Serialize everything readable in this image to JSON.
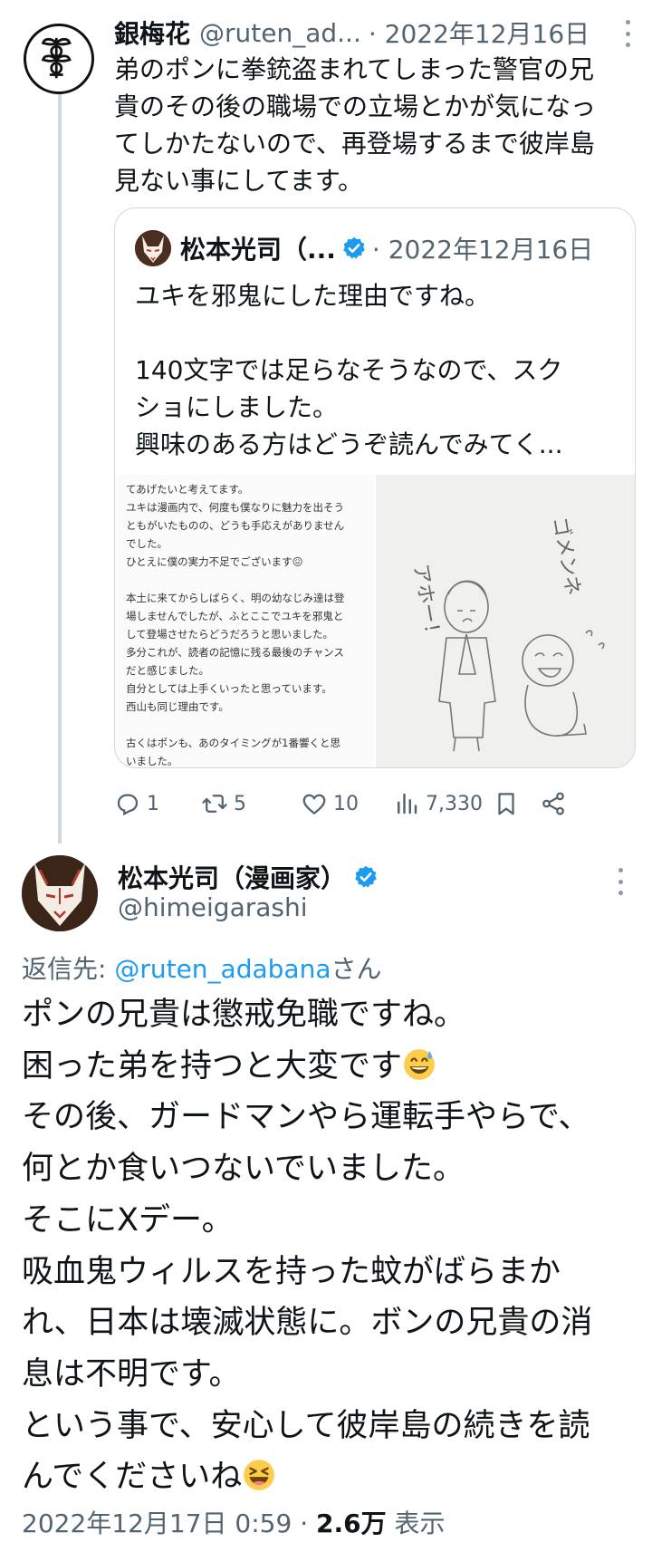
{
  "parent_tweet": {
    "display_name": "銀梅花",
    "handle": "@ruten_ad...",
    "date": "· 2022年12月16日",
    "text": "弟のポンに拳銃盗まれてしまった警官の兄\n貴のその後の職場での立場とかが気になっ\nてしかたないので、再登場するまで彼岸島\n見ない事にしてます。"
  },
  "quoted_tweet": {
    "display_name": "松本光司（...",
    "date": "· 2022年12月16日",
    "text": "ユキを邪鬼にした理由ですね。\n\n140文字では足らなそうなので、スク\nショにしました。\n興味のある方はどうぞ読んでみてく...",
    "screenshot_text": "てあげたいと考えてます。\nユキは漫画内で、何度も僕なりに魅力を出そう\nともがいたものの、どうも手応えがありません\nでした。\nひとえに僕の実力不足でございます😖\n\n本土に来てからしばらく、明の幼なじみ達は登\n場しませんでしたが、ふとここでユキを邪鬼と\nして登場させたらどうだろうと思いました。\n多分これが、読者の記憶に残る最後のチャンス\nだと感じました。\n自分としては上手くいったと思っています。\n西山も同じ理由です。\n\n古くはポンも、あのタイミングが1番響くと思\nいました。",
    "drawing_text_left": "アホー！",
    "drawing_text_right": "ゴメンネ"
  },
  "actions": {
    "replies": "1",
    "retweets": "5",
    "likes": "10",
    "views": "7,330"
  },
  "main_tweet": {
    "display_name": "松本光司（漫画家）",
    "handle": "@himeigarashi",
    "replying_prefix": "返信先: ",
    "replying_mention": "@ruten_adabana",
    "replying_suffix": "さん",
    "line1": "ポンの兄貴は懲戒免職ですね。",
    "line2": "困った弟を持つと大変です",
    "line3": "その後、ガードマンやら運転手やらで、\n何とか食いつないでいました。\nそこにXデー。\n吸血鬼ウィルスを持った蚊がばらまか\nれ、日本は壊滅状態に。ボンの兄貴の消\n息は不明です。\nという事で、安心して彼岸島の続きを読\nんでくださいね",
    "timestamp": "2022年12月17日 0:59 · ",
    "view_count": "2.6万",
    "view_label": " 表示"
  },
  "colors": {
    "text": "#0f1419",
    "secondary": "#536471",
    "link": "#1d9bf0",
    "border": "#cfd9de"
  }
}
